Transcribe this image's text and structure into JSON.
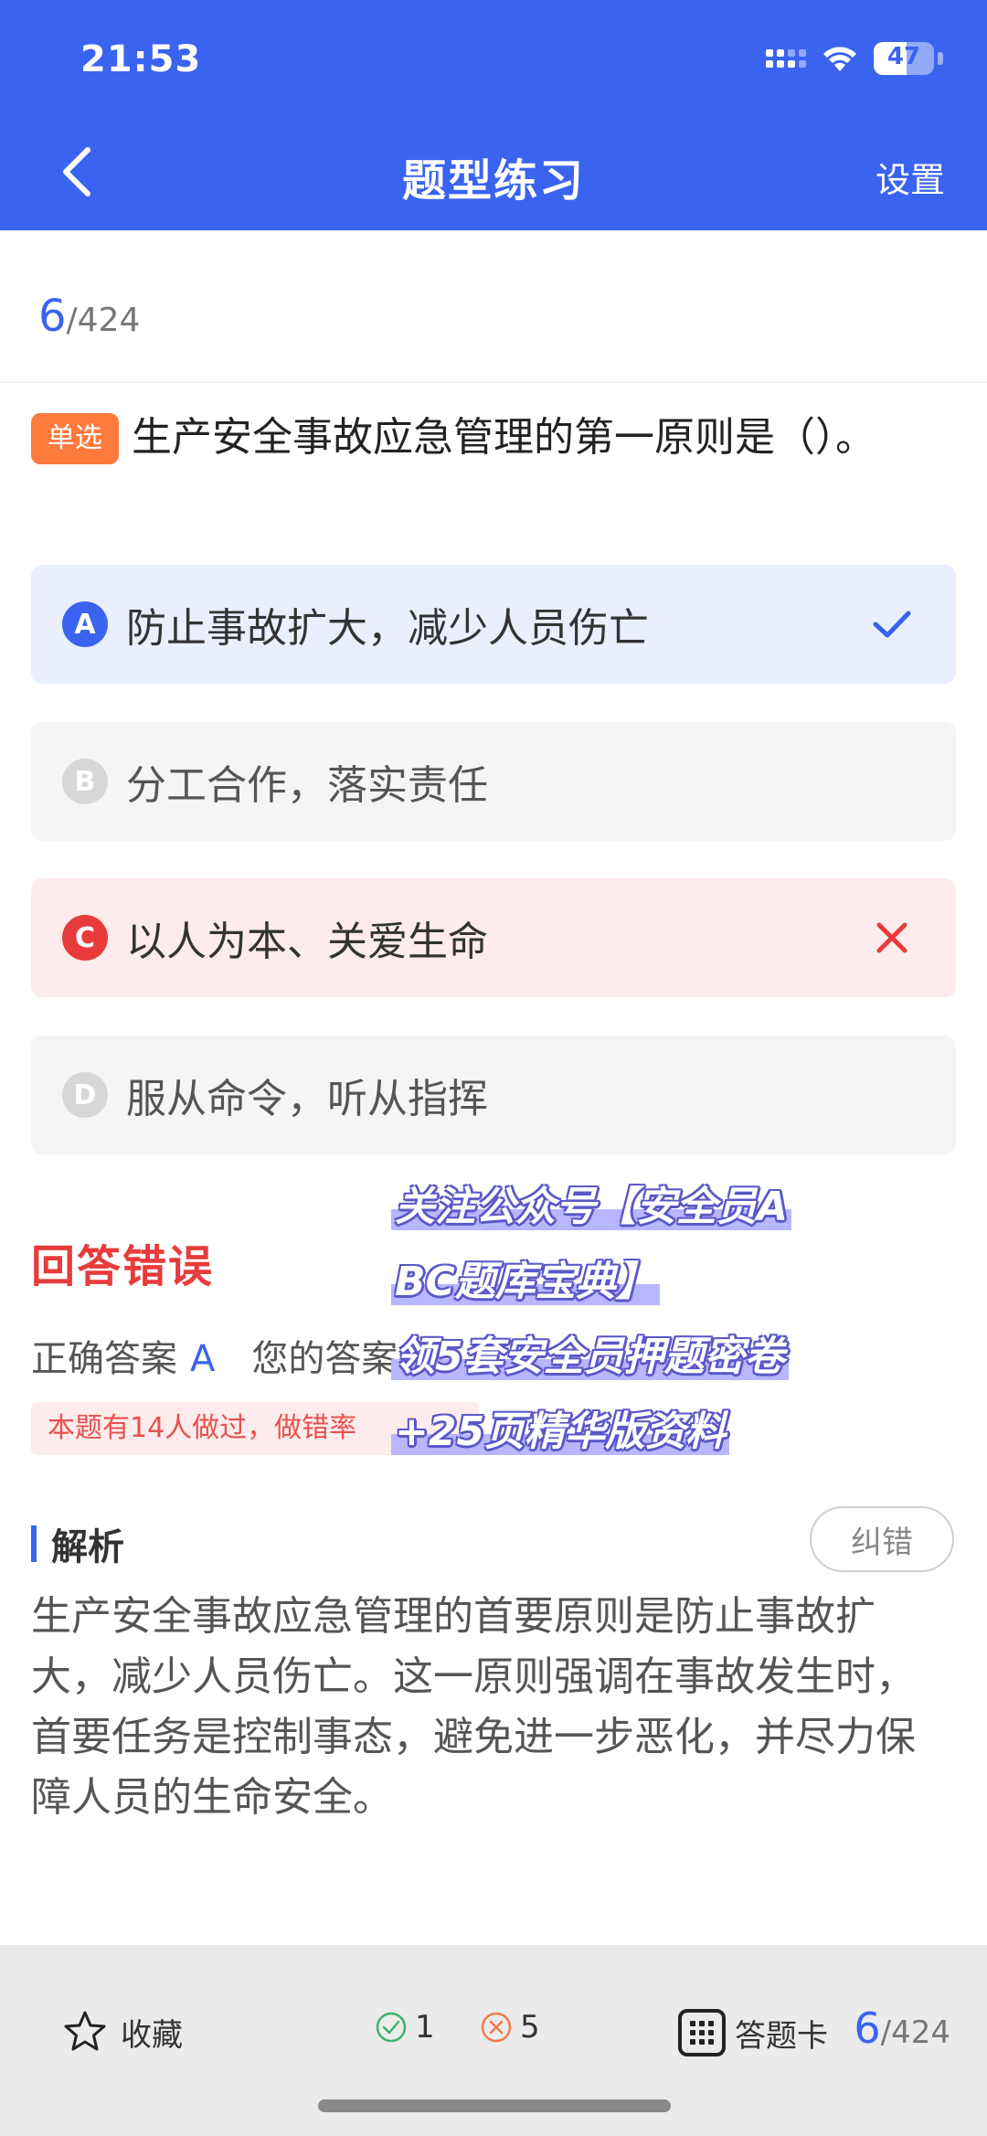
{
  "status_bar": {
    "time": "21:53",
    "battery": "47"
  },
  "header": {
    "title": "题型练习",
    "settings_label": "设置"
  },
  "progress": {
    "current": "6",
    "total": "/424"
  },
  "question": {
    "type_badge": "单选",
    "text": "生产安全事故应急管理的第一原则是（）。"
  },
  "options": [
    {
      "letter": "A",
      "text": "防止事故扩大，减少人员伤亡",
      "state": "correct"
    },
    {
      "letter": "B",
      "text": "分工合作，落实责任",
      "state": "none"
    },
    {
      "letter": "C",
      "text": "以人为本、关爱生命",
      "state": "wrong"
    },
    {
      "letter": "D",
      "text": "服从命令，听从指挥",
      "state": "none"
    }
  ],
  "result": {
    "title": "回答错误",
    "correct_label": "正确答案",
    "correct_answer": "A",
    "your_answer_label": "您的答案",
    "stats": "本题有14人做过，做错率"
  },
  "promo": {
    "line1": "关注公众号【安全员A",
    "line2": "BC题库宝典】",
    "line3": "领5套安全员押题密卷",
    "line4": "+25页精华版资料"
  },
  "analysis": {
    "label": "解析",
    "report_button": "纠错",
    "text": "生产安全事故应急管理的首要原则是防止事故扩大，减少人员伤亡。这一原则强调在事故发生时，首要任务是控制事态，避免进一步恶化，并尽力保障人员的生命安全。"
  },
  "bottom_bar": {
    "favorite_label": "收藏",
    "right_count": "1",
    "wrong_count": "5",
    "answer_card_label": "答题卡",
    "progress_current": "6",
    "progress_total": "/424"
  },
  "colors": {
    "primary": "#3a63f0",
    "error": "#e83b3b",
    "badge": "#ff7a3d"
  }
}
